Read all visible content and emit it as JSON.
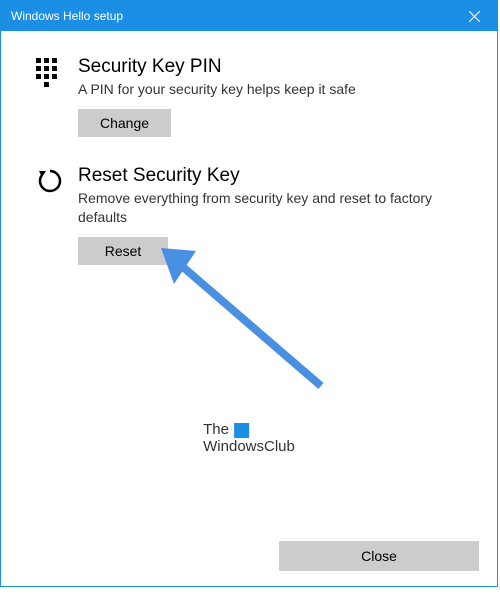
{
  "titlebar": {
    "title": "Windows Hello setup"
  },
  "sections": {
    "pin": {
      "title": "Security Key PIN",
      "desc": "A PIN for your security key helps keep it safe",
      "button": "Change"
    },
    "reset": {
      "title": "Reset Security Key",
      "desc": "Remove everything from security key and reset to factory defaults",
      "button": "Reset"
    }
  },
  "footer": {
    "close": "Close"
  },
  "watermark": {
    "line1": "The",
    "line2": "WindowsClub"
  },
  "colors": {
    "accent": "#1a8fe3",
    "button_bg": "#cccccc"
  },
  "annotation": {
    "arrow_color": "#4a90e2"
  }
}
